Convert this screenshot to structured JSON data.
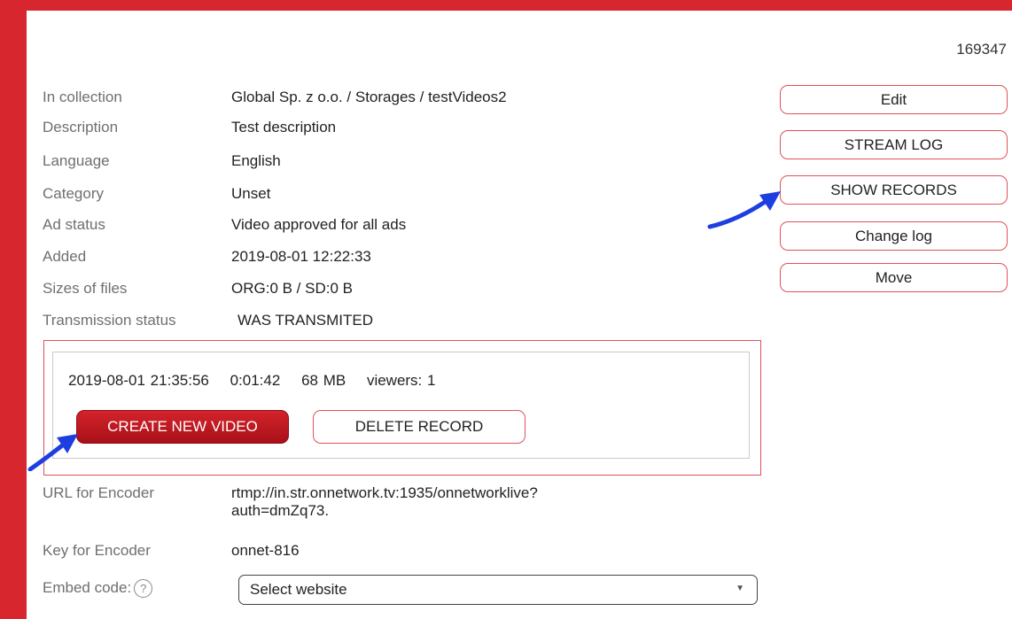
{
  "record_id": "169347",
  "details": [
    {
      "label": "In collection",
      "value": "Global Sp. z o.o. / Storages / testVideos2"
    },
    {
      "label": "Description",
      "value": "Test description"
    },
    {
      "label": "Language",
      "value": "English"
    },
    {
      "label": "Category",
      "value": "Unset"
    },
    {
      "label": "Ad status",
      "value": "Video approved for all ads"
    },
    {
      "label": "Added",
      "value": "2019-08-01 12:22:33"
    },
    {
      "label": "Sizes of files",
      "value": "ORG:0 B / SD:0 B"
    },
    {
      "label": "Transmission status",
      "value": "WAS TRANSMITED"
    }
  ],
  "side_buttons": [
    "Edit",
    "STREAM LOG",
    "SHOW RECORDS",
    "Change log",
    "Move"
  ],
  "record": {
    "datetime": "2019-08-01 21:35:56",
    "duration": "0:01:42",
    "size": "68 MB",
    "viewers": "viewers: 1",
    "create_label": "CREATE NEW VIDEO",
    "delete_label": "DELETE RECORD"
  },
  "encoder": {
    "url_label": "URL for Encoder",
    "url_line1": "rtmp://in.str.onnetwork.tv:1935/onnetworklive?",
    "url_line2": "auth=dmZq73.",
    "key_label": "Key for Encoder",
    "key_value": "onnet-816",
    "embed_label": "Embed code:",
    "help_glyph": "?",
    "select_value": "Select website"
  },
  "colors": {
    "frame": "#d7262d",
    "accent_border": "#e0525a",
    "primary_button": "#c41922",
    "annotation_arrow": "#1d3fe0"
  }
}
